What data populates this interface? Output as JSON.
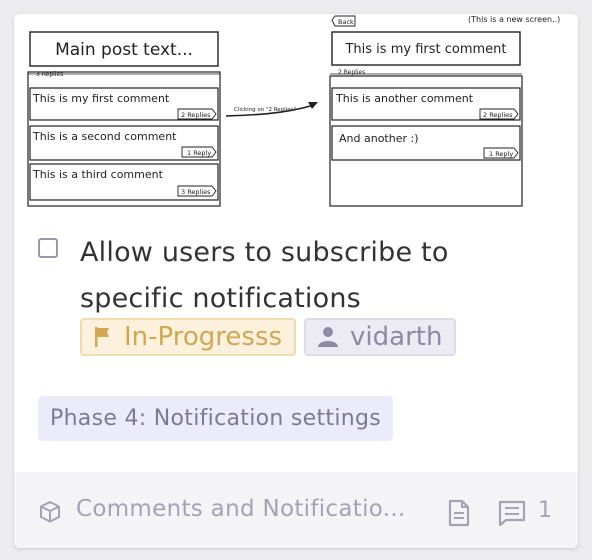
{
  "mockup": {
    "main_post": "Main post text...",
    "replies_label": "3 Replies",
    "comments": [
      {
        "text": "This is my first comment",
        "badge": "2 Replies"
      },
      {
        "text": "This is a second comment",
        "badge": "1 Reply"
      },
      {
        "text": "This is a third comment",
        "badge": "3 Replies"
      }
    ],
    "arrow_label": "Clicking on \"2 Replies\"",
    "back_label": "Back",
    "new_screen_note": "(This is a new screen..)",
    "right_header": "This is my first comment",
    "right_replies_label": "2 Replies",
    "right_comments": [
      {
        "text": "This is another comment",
        "badge": "2 Replies"
      },
      {
        "text": "And another :)",
        "badge": "1 Reply"
      }
    ]
  },
  "task": {
    "title": "Allow users to subscribe to specific notifications",
    "status": "In-Progresss",
    "assignee": "vidarth",
    "phase": "Phase 4: Notification settings"
  },
  "footer": {
    "project": "Comments and Notificatio...",
    "comment_count": "1"
  },
  "colors": {
    "status_bg": "#fbf1dd",
    "status_text": "#d3a653",
    "assignee_bg": "#ecebf3",
    "phase_bg": "#ebebfa"
  }
}
